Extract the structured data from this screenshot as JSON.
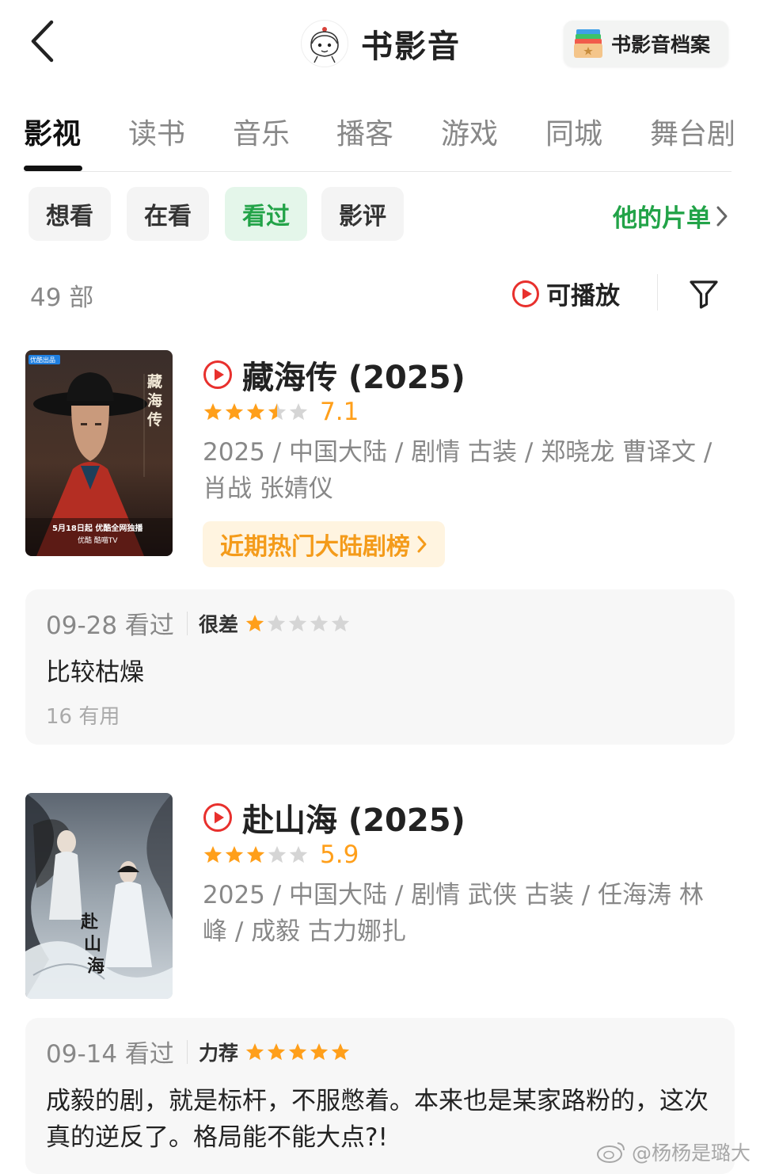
{
  "header": {
    "title": "书影音",
    "archive_label": "书影音档案"
  },
  "tabs": [
    "影视",
    "读书",
    "音乐",
    "播客",
    "游戏",
    "同城",
    "舞台剧"
  ],
  "active_tab": "影视",
  "filters": {
    "chips": [
      "想看",
      "在看",
      "看过",
      "影评"
    ],
    "active": "看过",
    "playlist_label": "他的片单"
  },
  "list": {
    "count": "49 部",
    "playable_label": "可播放"
  },
  "movies": [
    {
      "title": "藏海传 (2025)",
      "stars": 3.5,
      "score": "7.1",
      "meta": "2025 / 中国大陆 / 剧情 古装 / 郑晓龙 曹译文 / 肖战 张婧仪",
      "rank_label": "近期热门大陆剧榜",
      "poster": {
        "badge": "优酷出品",
        "vertical_title": "藏海传",
        "release": "5月18日起 优酷全网独播",
        "platforms": "优酷  酷喵TV"
      },
      "review": {
        "date": "09-28 看过",
        "level": "很差",
        "stars": 1,
        "text": "比较枯燥",
        "useful": "16 有用"
      }
    },
    {
      "title": "赴山海 (2025)",
      "stars": 3,
      "score": "5.9",
      "meta": "2025 / 中国大陆 / 剧情 武侠 古装 / 任海涛 林峰 / 成毅 古力娜扎",
      "poster": {
        "vertical_title": "赴山海"
      },
      "review": {
        "date": "09-14 看过",
        "level": "力荐",
        "stars": 5,
        "text": "成毅的剧，就是标杆，不服憋着。本来也是某家路粉的，这次真的逆反了。格局能不能大点?!"
      }
    }
  ],
  "watermark": "@杨杨是璐大",
  "colors": {
    "green": "#22a348",
    "orange": "#ff9f1a",
    "play_red": "#e8302d",
    "star_gray": "#d5d5d5"
  }
}
